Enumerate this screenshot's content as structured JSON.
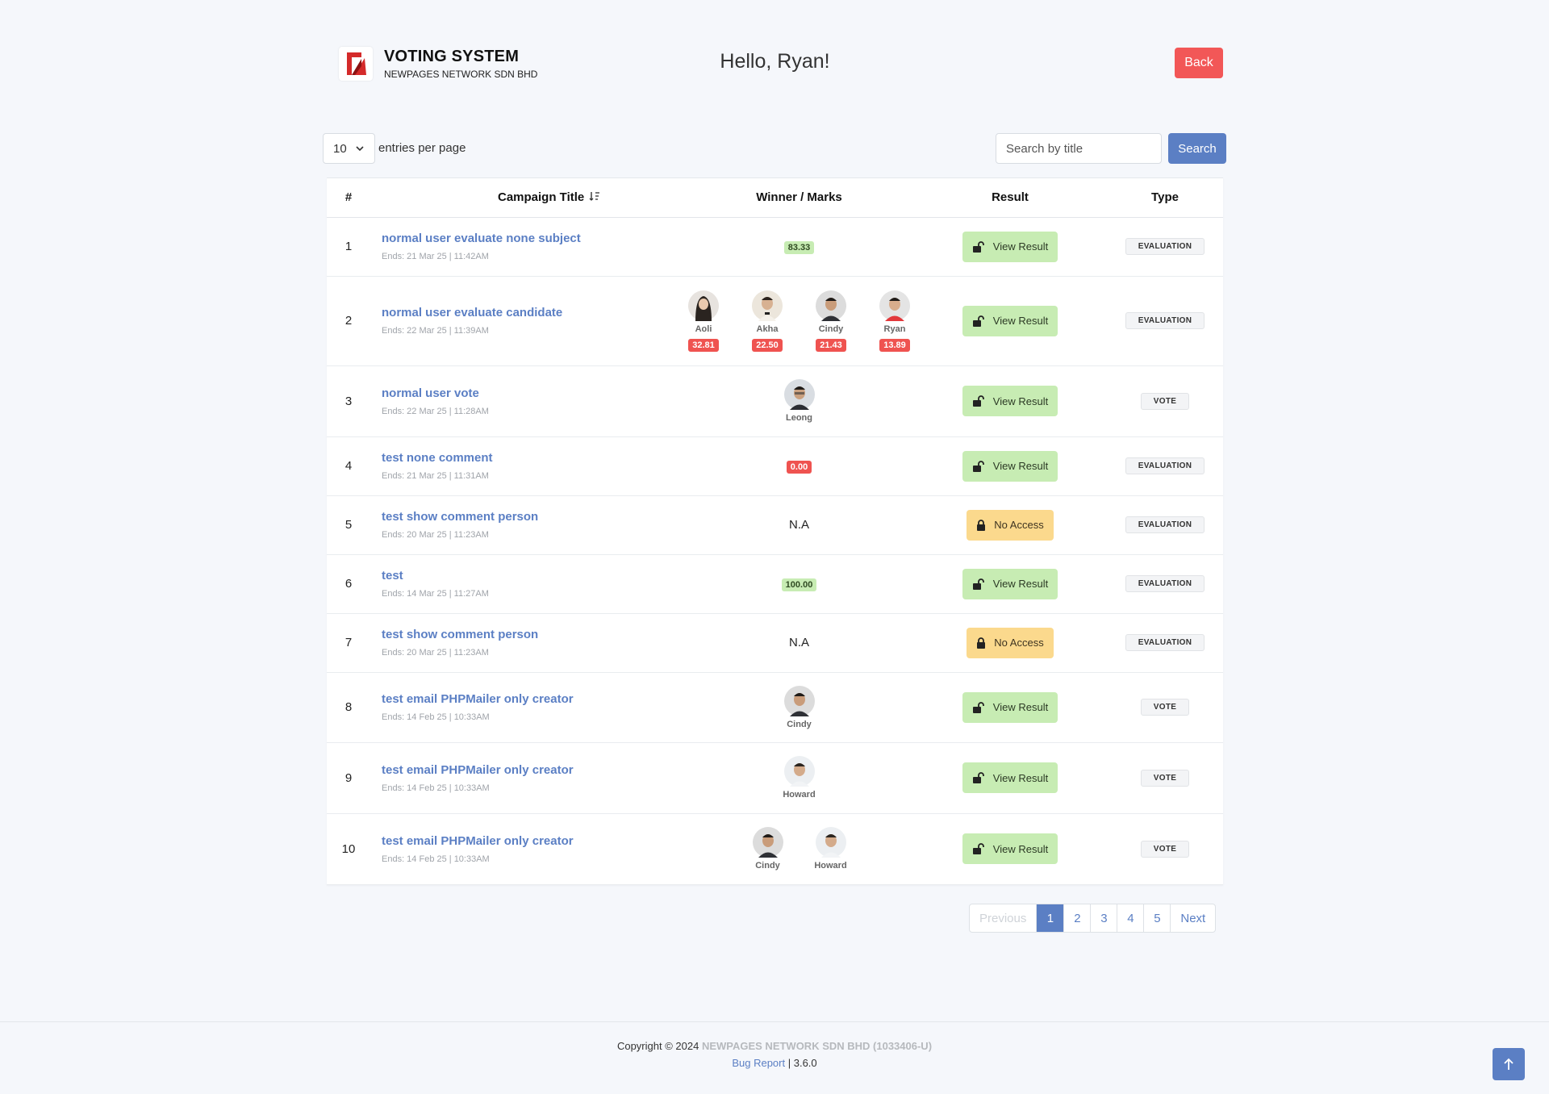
{
  "app": {
    "title": "VOTING SYSTEM",
    "subtitle": "NEWPAGES NETWORK SDN BHD",
    "greeting": "Hello, Ryan!",
    "back_label": "Back"
  },
  "toolbar": {
    "entries_value": "10",
    "entries_label": "entries per page",
    "search_placeholder": "Search by title",
    "search_label": "Search"
  },
  "table": {
    "headers": {
      "num": "#",
      "title": "Campaign Title",
      "winner": "Winner / Marks",
      "result": "Result",
      "type": "Type"
    },
    "rows": [
      {
        "num": "1",
        "title": "normal user evaluate none subject",
        "ends": "Ends: 21 Mar 25 | 11:42AM",
        "score": "83.33",
        "result": "View Result",
        "type": "EVALUATION"
      },
      {
        "num": "2",
        "title": "normal user evaluate candidate",
        "ends": "Ends: 22 Mar 25 | 11:39AM",
        "candidates": [
          {
            "name": "Aoli",
            "score": "32.81"
          },
          {
            "name": "Akha",
            "score": "22.50"
          },
          {
            "name": "Cindy",
            "score": "21.43"
          },
          {
            "name": "Ryan",
            "score": "13.89"
          }
        ],
        "result": "View Result",
        "type": "EVALUATION"
      },
      {
        "num": "3",
        "title": "normal user vote",
        "ends": "Ends: 22 Mar 25 | 11:28AM",
        "winners": [
          "Leong"
        ],
        "result": "View Result",
        "type": "VOTE"
      },
      {
        "num": "4",
        "title": "test none comment",
        "ends": "Ends: 21 Mar 25 | 11:31AM",
        "score": "0.00",
        "result": "View Result",
        "type": "EVALUATION"
      },
      {
        "num": "5",
        "title": "test show comment person",
        "ends": "Ends: 20 Mar 25 | 11:23AM",
        "winner_text": "N.A",
        "result": "No Access",
        "type": "EVALUATION"
      },
      {
        "num": "6",
        "title": "test",
        "ends": "Ends: 14 Mar 25 | 11:27AM",
        "score": "100.00",
        "result": "View Result",
        "type": "EVALUATION"
      },
      {
        "num": "7",
        "title": "test show comment person",
        "ends": "Ends: 20 Mar 25 | 11:23AM",
        "winner_text": "N.A",
        "result": "No Access",
        "type": "EVALUATION"
      },
      {
        "num": "8",
        "title": "test email PHPMailer only creator",
        "ends": "Ends: 14 Feb 25 | 10:33AM",
        "winners": [
          "Cindy"
        ],
        "result": "View Result",
        "type": "VOTE"
      },
      {
        "num": "9",
        "title": "test email PHPMailer only creator",
        "ends": "Ends: 14 Feb 25 | 10:33AM",
        "winners": [
          "Howard"
        ],
        "result": "View Result",
        "type": "VOTE"
      },
      {
        "num": "10",
        "title": "test email PHPMailer only creator",
        "ends": "Ends: 14 Feb 25 | 10:33AM",
        "winners": [
          "Cindy",
          "Howard"
        ],
        "result": "View Result",
        "type": "VOTE"
      }
    ]
  },
  "pagination": {
    "previous": "Previous",
    "pages": [
      "1",
      "2",
      "3",
      "4",
      "5"
    ],
    "active": "1",
    "next": "Next"
  },
  "footer": {
    "copyright": "Copyright © 2024",
    "company": "NEWPAGES NETWORK SDN BHD (1033406-U)",
    "bug_report": "Bug Report",
    "separator": "|",
    "version": "3.6.0"
  },
  "colors": {
    "accent": "#5b7fc4",
    "danger": "#f25757",
    "success_bg": "#c7ecb3",
    "warning_bg": "#fbd98d"
  },
  "icons": {
    "logo": "newpages-logo",
    "sort": "sort-icon",
    "view": "unlock-icon",
    "noaccess": "lock-icon",
    "top": "arrow-up-icon"
  }
}
